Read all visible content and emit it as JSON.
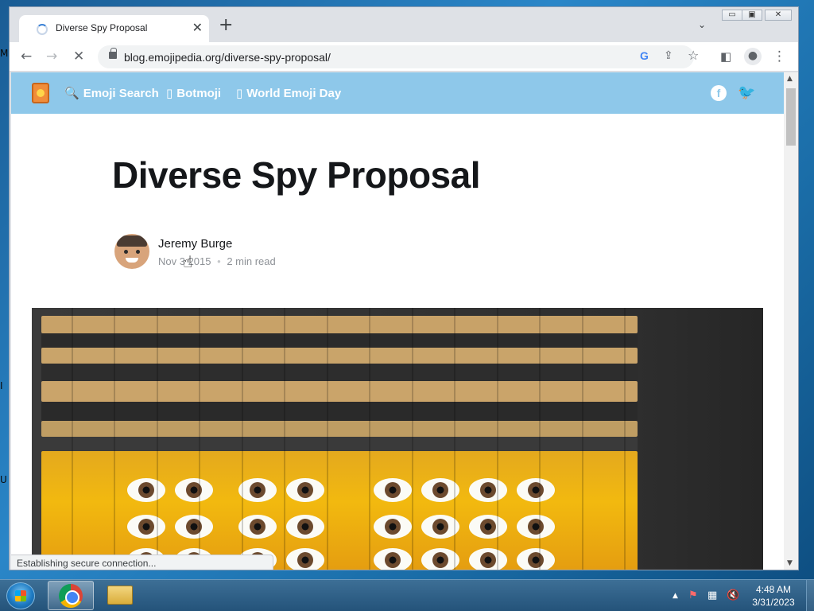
{
  "browser": {
    "tab_title": "Diverse Spy Proposal",
    "tab_close_glyph": "✕",
    "new_tab_glyph": "+",
    "tab_search_glyph": "⌄",
    "url": "blog.emojipedia.org/diverse-spy-proposal/",
    "back_glyph": "←",
    "forward_glyph": "→",
    "stop_glyph": "✕",
    "share_glyph": "⇪",
    "bookmark_glyph": "☆",
    "sidepanel_glyph": "◧",
    "profile_glyph": "●",
    "menu_glyph": "⋮",
    "google_glyph": "G",
    "window_controls": {
      "minimize": "▭",
      "maximize": "▣",
      "close": "✕"
    },
    "status_text": "Establishing secure connection..."
  },
  "site": {
    "nav": [
      {
        "icon": "🔍",
        "label": "Emoji Search"
      },
      {
        "icon": "▯",
        "label": "Botmoji"
      },
      {
        "icon": "▯",
        "label": "World Emoji Day"
      }
    ],
    "social": {
      "facebook": "f",
      "twitter": "🐦"
    }
  },
  "post": {
    "title": "Diverse Spy Proposal",
    "author": "Jeremy Burge",
    "date": "Nov 3 2015",
    "read_time": "2 min read",
    "meta_separator": "•"
  },
  "taskbar": {
    "time": "4:48 AM",
    "date": "3/31/2023",
    "tray_up_glyph": "▲",
    "tray_flag_glyph": "⚑",
    "tray_network_glyph": "▦",
    "tray_volume_glyph": "🔇"
  },
  "desktop": {
    "left_edge_glyphs": [
      "M",
      "I",
      "U"
    ]
  },
  "colors": {
    "site_nav_bg": "#8ec8ea",
    "title_text": "#15171a",
    "meta_text": "#8e9297"
  }
}
